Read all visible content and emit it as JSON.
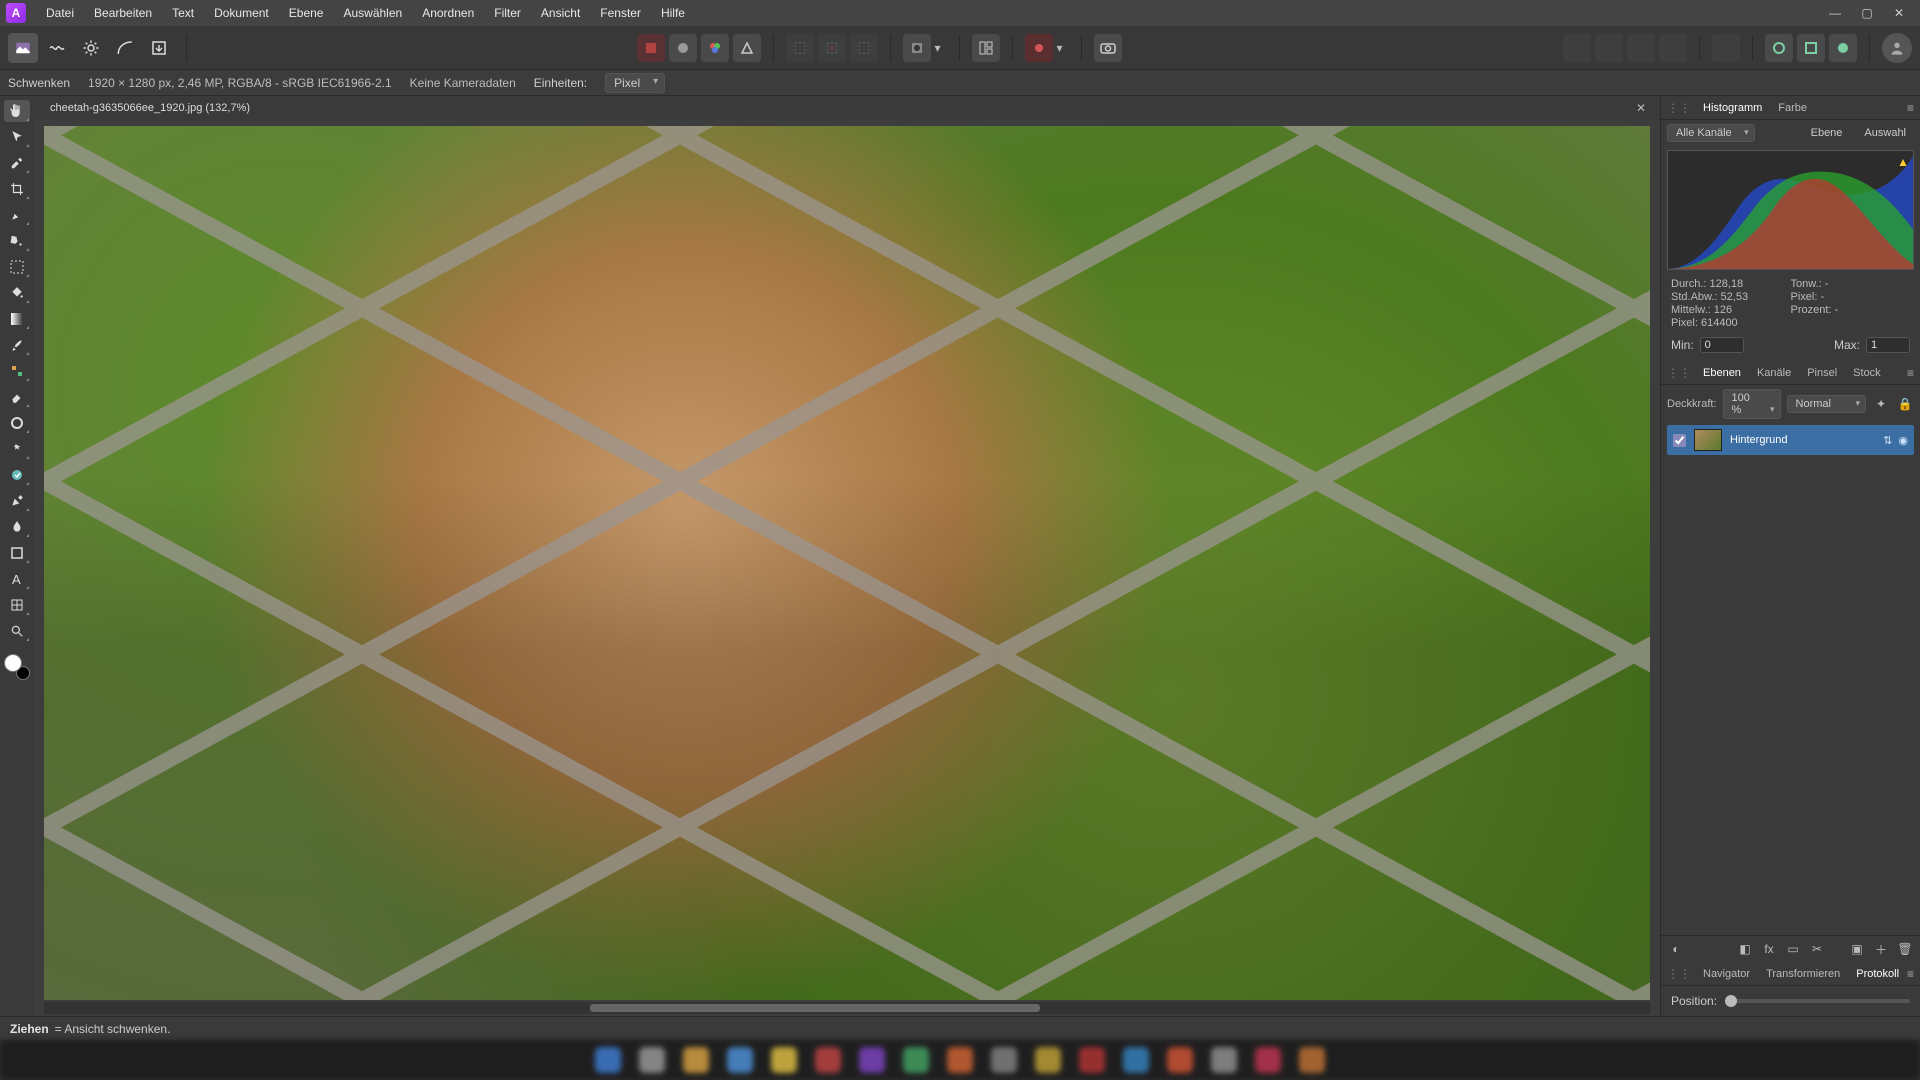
{
  "menubar": {
    "items": [
      "Datei",
      "Bearbeiten",
      "Text",
      "Dokument",
      "Ebene",
      "Auswählen",
      "Anordnen",
      "Filter",
      "Ansicht",
      "Fenster",
      "Hilfe"
    ]
  },
  "context": {
    "tool_name": "Schwenken",
    "dims": "1920 × 1280 px, 2,46 MP, RGBA/8 - sRGB IEC61966-2.1",
    "camera": "Keine Kameradaten",
    "units_label": "Einheiten:",
    "units_value": "Pixel"
  },
  "doc": {
    "tab_title": "cheetah-g3635066ee_1920.jpg (132,7%)"
  },
  "panels": {
    "histogram_tab": "Histogramm",
    "color_tab": "Farbe",
    "channels_dropdown": "Alle Kanäle",
    "scope_layer": "Ebene",
    "scope_selection": "Auswahl",
    "stats": {
      "mean_label": "Durch.:",
      "mean": "128,18",
      "stddev_label": "Std.Abw.:",
      "stddev": "52,53",
      "median_label": "Mittelw.:",
      "median": "126",
      "pixels_label": "Pixel:",
      "pixels": "614400",
      "tonw_label": "Tonw.:",
      "tonw": "-",
      "pixel2_label": "Pixel:",
      "pixel2": "-",
      "percent_label": "Prozent:",
      "percent": "-"
    },
    "min_label": "Min:",
    "min_value": "0",
    "max_label": "Max:",
    "max_value": "1",
    "layers_tabs": [
      "Ebenen",
      "Kanäle",
      "Pinsel",
      "Stock"
    ],
    "opacity_label": "Deckkraft:",
    "opacity_value": "100 %",
    "blend_mode": "Normal",
    "layer_name": "Hintergrund",
    "bottom_tabs": [
      "Navigator",
      "Transformieren",
      "Protokoll"
    ],
    "position_label": "Position:"
  },
  "status": {
    "action": "Ziehen",
    "desc": "= Ansicht schwenken."
  }
}
